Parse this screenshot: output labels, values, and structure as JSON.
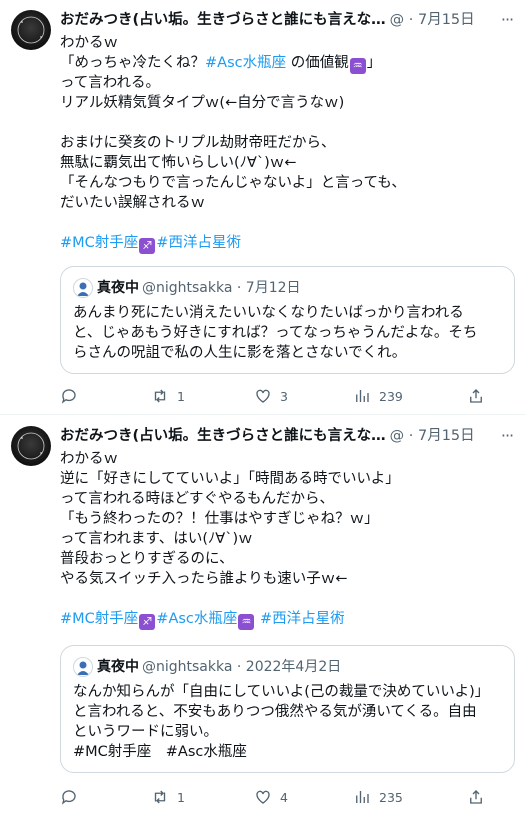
{
  "tweets": [
    {
      "author_name": "おだみつき(占い垢。生きづらさと誰にも言えな…",
      "meta": "@ · 7月15日",
      "more": "···",
      "lines": [
        "わかるｗ",
        "「めっちゃ冷たくね？",
        "って言われる。",
        "リアル妖精気質タイプｗ(←自分で言うなｗ)",
        "",
        "おまけに癸亥のトリプル劫財帝旺だから、",
        "無駄に覇気出て怖いらしい(ﾉ∀`)ｗ←",
        "「そんなつもりで言ったんじゃないよ」と言っても、",
        "だいたい誤解されるｗ",
        ""
      ],
      "line2_hashtag": "#Asc水瓶座",
      "line2_tail": " の価値観",
      "line2_end": "」",
      "hashtags": [
        "#MC射手座",
        "#西洋占星術"
      ],
      "quote": {
        "name": "真夜中",
        "handle_date": "@nightsakka · 7月12日",
        "lines": [
          "あんまり死にたい消えたいいなくなりたいばっかり言われる",
          "と、じゃあもう好きにすれば？ってなっちゃうんだよな。そち",
          "らさんの呪詛で私の人生に影を落とさないでくれ。"
        ]
      },
      "actions": {
        "replies": "",
        "retweets": "1",
        "likes": "3",
        "views": "239"
      }
    },
    {
      "author_name": "おだみつき(占い垢。生きづらさと誰にも言えな…",
      "meta": "@ · 7月15日",
      "more": "···",
      "lines": [
        "わかるｗ",
        "逆に「好きにしてていいよ」「時間ある時でいいよ」",
        "って言われる時ほどすぐやるもんだから、",
        "「もう終わったの？！仕事はやすぎじゃね？ｗ」",
        "って言われます、はい(ﾉ∀`)ｗ",
        "普段おっとりすぎるのに、",
        "やる気スイッチ入ったら誰よりも速い子ｗ←",
        ""
      ],
      "hashtags": [
        "#MC射手座",
        "#Asc水瓶座",
        " #西洋占星術"
      ],
      "quote": {
        "name": "真夜中",
        "handle_date": "@nightsakka · 2022年4月2日",
        "lines": [
          "なんか知らんが「自由にしていいよ(己の裁量で決めていいよ)」",
          "と言われると、不安もありつつ俄然やる気が湧いてくる。自由",
          "というワードに弱い。",
          "#MC射手座　#Asc水瓶座"
        ]
      },
      "actions": {
        "replies": "",
        "retweets": "1",
        "likes": "4",
        "views": "235"
      }
    }
  ],
  "icons": {
    "sagittarius": "♐",
    "aquarius": "♒",
    "reply": "reply-icon",
    "retweet": "retweet-icon",
    "like": "heart-icon",
    "views": "views-icon",
    "share": "share-icon"
  },
  "colors": {
    "link": "#1d9bf0",
    "muted": "#536471",
    "zodiac": "#8b4fd1"
  }
}
